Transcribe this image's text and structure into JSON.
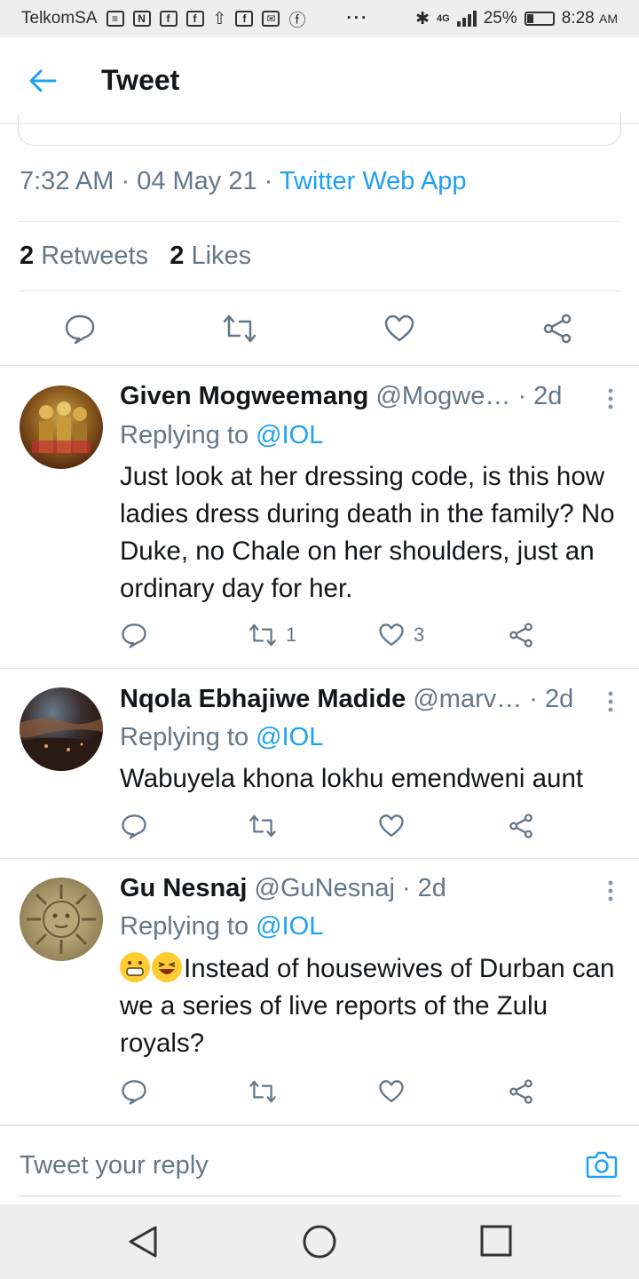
{
  "status_bar": {
    "carrier": "TelkomSA",
    "battery": "25%",
    "battery_level": 0.25,
    "time": "8:28",
    "ampm": "AM",
    "network": "4G"
  },
  "header": {
    "title": "Tweet"
  },
  "tweet": {
    "time": "7:32 AM",
    "date": "04 May 21",
    "app": "Twitter Web App",
    "retweet_count": "2",
    "retweet_label": "Retweets",
    "like_count": "2",
    "like_label": "Likes"
  },
  "replies": [
    {
      "name": "Given Mogweemang",
      "handle": "@Mogwe…",
      "time": "· 2d",
      "replying_prefix": "Replying to",
      "replying_to": "@IOL",
      "text": "Just look at her dressing code, is this how ladies dress during death in the family?  No Duke, no Chale on her shoulders, just an ordinary day for her.",
      "retweets": "1",
      "likes": "3"
    },
    {
      "name": "Nqola Ebhajiwe Madide",
      "handle": "@marv…",
      "time": "· 2d",
      "replying_prefix": "Replying to",
      "replying_to": "@IOL",
      "text": "Wabuyela khona lokhu emendweni aunt",
      "retweets": "",
      "likes": ""
    },
    {
      "name": "Gu Nesnaj",
      "handle": "@GuNesnaj",
      "time": "· 2d",
      "replying_prefix": "Replying to",
      "replying_to": "@IOL",
      "text": "Instead of housewives of Durban can we a series of live reports of the Zulu royals?",
      "retweets": "",
      "likes": ""
    }
  ],
  "composer": {
    "placeholder": "Tweet your reply"
  },
  "colors": {
    "accent": "#1da1f2",
    "muted": "#657786",
    "text": "#14171a"
  }
}
